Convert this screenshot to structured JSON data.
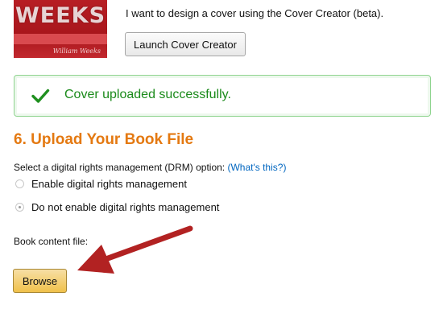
{
  "cover_option": {
    "thumbnail": {
      "title": "WEEKS",
      "author": "William Weeks"
    },
    "text": "I want to design a cover using the Cover Creator (beta).",
    "launch_button_label": "Launch Cover Creator"
  },
  "success_alert": {
    "message": "Cover uploaded successfully.",
    "icon": "checkmark-icon",
    "color": "#1a8a1a"
  },
  "section": {
    "title": "6. Upload Your Book File",
    "title_color": "#e47911"
  },
  "drm": {
    "label": "Select a digital rights management (DRM) option:",
    "help_link": "(What's this?)",
    "options": [
      {
        "label": "Enable digital rights management",
        "selected": false
      },
      {
        "label": "Do not enable digital rights management",
        "selected": true
      }
    ]
  },
  "book_file": {
    "label": "Book content file:",
    "browse_button_label": "Browse"
  },
  "annotation": {
    "icon": "red-arrow-icon",
    "color": "#b22222"
  }
}
